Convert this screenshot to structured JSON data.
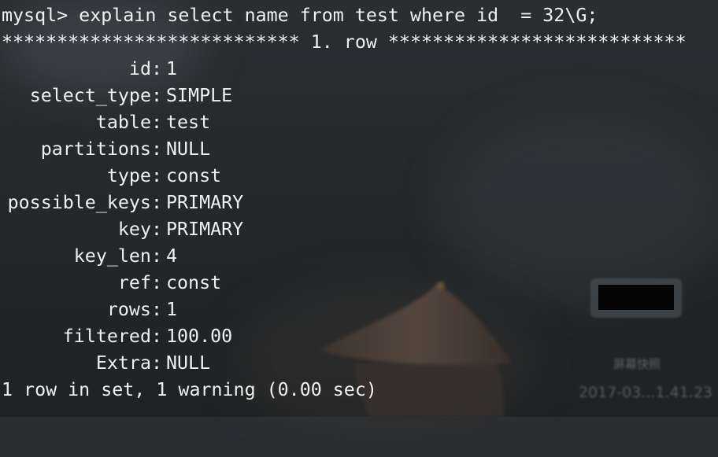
{
  "terminal": {
    "command": "mysql> explain select name from test where id  = 32\\G;",
    "row_header": "*************************** 1. row ***************************",
    "fields": [
      {
        "key": "id:",
        "value": "1"
      },
      {
        "key": "select_type:",
        "value": "SIMPLE"
      },
      {
        "key": "table:",
        "value": "test"
      },
      {
        "key": "partitions:",
        "value": "NULL"
      },
      {
        "key": "type:",
        "value": "const"
      },
      {
        "key": "possible_keys:",
        "value": "PRIMARY"
      },
      {
        "key": "key:",
        "value": "PRIMARY"
      },
      {
        "key": "key_len:",
        "value": "4"
      },
      {
        "key": "ref:",
        "value": "const"
      },
      {
        "key": "rows:",
        "value": "1"
      },
      {
        "key": "filtered:",
        "value": "100.00"
      },
      {
        "key": "Extra:",
        "value": "NULL"
      }
    ],
    "summary": "1 row in set, 1 warning (0.00 sec)"
  },
  "watermark": {
    "label": "屏幕快照",
    "timestamp": "2017-03...1.41.23"
  }
}
